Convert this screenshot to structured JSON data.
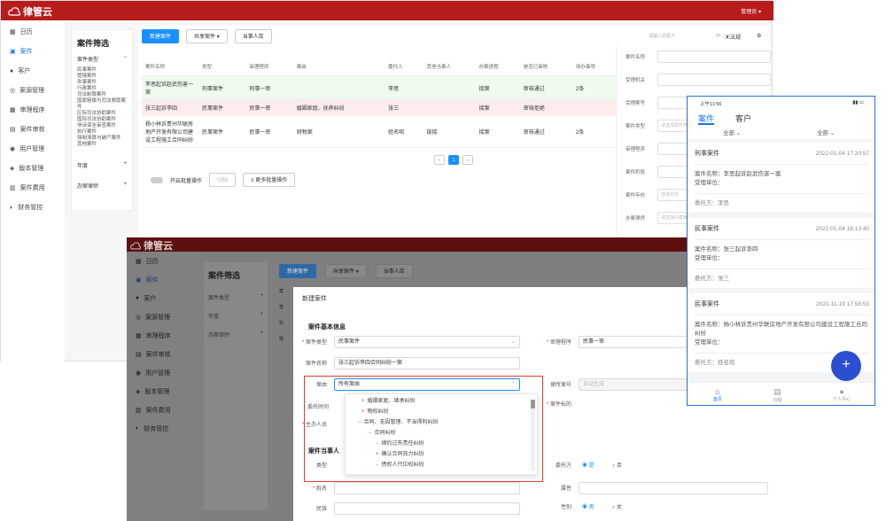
{
  "top_app": {
    "brand": "律管云",
    "header_user": "管理员",
    "header_user_arrow": "▾",
    "sidebar": [
      "日历",
      "案件",
      "客户",
      "案源管理",
      "审理程序",
      "案件审核",
      "用户管理",
      "版本管理",
      "案件费用",
      "财务管控"
    ],
    "filter": {
      "title": "案件筛选",
      "type_label": "案件类型",
      "types": [
        "民事案件",
        "管辖案件",
        "刑事案件",
        "行政案件",
        "司法制裁案件",
        "国家赔偿与司法救助案件",
        "区际司法协助案件",
        "国际司法协助案件",
        "非诉保全审查案件",
        "执行案件",
        "强制清算与破产案件",
        "其他案件"
      ],
      "year_label": "年度",
      "lawyer_label": "办案律师"
    },
    "toolbar": {
      "new_case": "新建案件",
      "share_case": "共享案件",
      "into_case_library": "当事人库",
      "search_placeholder": "请输入办案人",
      "regulation": "法规"
    },
    "table": {
      "columns": [
        "案件名称",
        "类型",
        "审理程序",
        "案由",
        "委托人",
        "其他当事人",
        "办案进程",
        "是否已审核",
        "待办事项"
      ],
      "rows": [
        {
          "name": "李思起诉赵武伤害一案",
          "type": "刑事案件",
          "procedure": "刑事一审",
          "cause": "",
          "client": "李思",
          "other": "",
          "progress": "接案",
          "review": "审核通过",
          "todo": "2条"
        },
        {
          "name": "张三起诉李四",
          "type": "民事案件",
          "procedure": "民事一审",
          "cause": "婚姻家庭、抚养纠纷",
          "client": "张三",
          "other": "",
          "progress": "接案",
          "review": "审核拒绝",
          "todo": ""
        },
        {
          "name": "杨小林诉贵州华联房地产开发有限公司建设工程施工合同纠纷",
          "type": "民事案件",
          "procedure": "民事一审",
          "cause": "财税案",
          "client": "姓名昭",
          "other": "链接",
          "progress": "接案",
          "review": "审核通过",
          "todo": "2条"
        }
      ],
      "pagination": {
        "current": "1"
      }
    },
    "batch": {
      "toggle": "开启批量操作",
      "archive": "归档",
      "more": "更多批量操作"
    },
    "right_filters": [
      "案件名称",
      "受理机关",
      "受理案号",
      "案件类型",
      "审理程序",
      "案件阶段",
      "案件年份",
      "办案律师"
    ],
    "right_placeholders": {
      "case_type": "请选择案件类型",
      "year": "选择年份",
      "lawyer": "请选择办案律师"
    }
  },
  "bottom_app": {
    "brand": "律管云",
    "sidebar": [
      "日历",
      "案件",
      "客户",
      "案源管理",
      "审理程序",
      "案件审核",
      "用户管理",
      "版本管理",
      "案件费用",
      "财务管控"
    ],
    "filter": {
      "title": "案件筛选",
      "items": [
        "案件类型",
        "年度",
        "办案律师"
      ]
    },
    "toolbar": {
      "new_case": "新建案件",
      "share_case": "共享案件",
      "into_case_library": "当事人库"
    },
    "modal": {
      "title": "新建案件",
      "section_basic": "案件基本信息",
      "case_type_label": "案件类型",
      "case_type_value": "民事案件",
      "procedure_label": "审理程序",
      "procedure_value": "民事一审",
      "case_name_label": "案件名称",
      "case_name_value": "张三起诉李四合同纠纷一案",
      "cause_label": "案由",
      "cause_value": "所有案由",
      "lawyer_no_label": "律所案号",
      "lawyer_no_placeholder": "自动生成",
      "entrust_time_label": "委托时间",
      "case_target_label": "案件标的",
      "lead_lawyer_label": "主办人员",
      "section_party": "案件当事人",
      "party_type_label": "类型",
      "name_label": "姓名",
      "ethnic_label": "民族",
      "client_label": "委托方",
      "client_yes": "是",
      "client_no": "否",
      "attr_label": "属性",
      "gender_label": "性别",
      "gender_male": "男",
      "gender_female": "女",
      "dropdown_items": [
        "婚姻家庭、继承纠纷",
        "物权纠纷",
        "合同、无因管理、不当得利纠纷",
        "合同纠纷",
        "缔约过失责任纠纷",
        "确认合同效力纠纷",
        "债权人代位权纠纷"
      ]
    }
  },
  "phone": {
    "time": "上午11:56",
    "tabs": [
      "案件",
      "客户"
    ],
    "filters": [
      "全部",
      "全部"
    ],
    "cards": [
      {
        "type": "刑事案件",
        "date": "2022-01-04 17:20:57",
        "name_label": "案件名称：",
        "name": "李思起诉赵武伤害一案",
        "unit_label": "受理单位：",
        "client_label": "委托方：",
        "client": "李思"
      },
      {
        "type": "民事案件",
        "date": "2022-01-04 16:13:40",
        "name_label": "案件名称：",
        "name": "张三起诉李四",
        "unit_label": "受理单位：",
        "client_label": "委托方：",
        "client": "张三"
      },
      {
        "type": "民事案件",
        "date": "2021-11-19 17:58:53",
        "name_label": "案件名称：",
        "name": "杨小林诉贵州华联房地产开发有限公司建设工程施工合同纠纷",
        "unit_label": "受理单位：",
        "client_label": "委托方：",
        "client": "姓名昭"
      }
    ],
    "bottom_nav": [
      "首页",
      "日程",
      "个人中心"
    ],
    "fab": "+"
  },
  "colors": {
    "header_bg": "#b71c1c",
    "primary": "#1890ff",
    "modal_highlight": "#e53935"
  }
}
